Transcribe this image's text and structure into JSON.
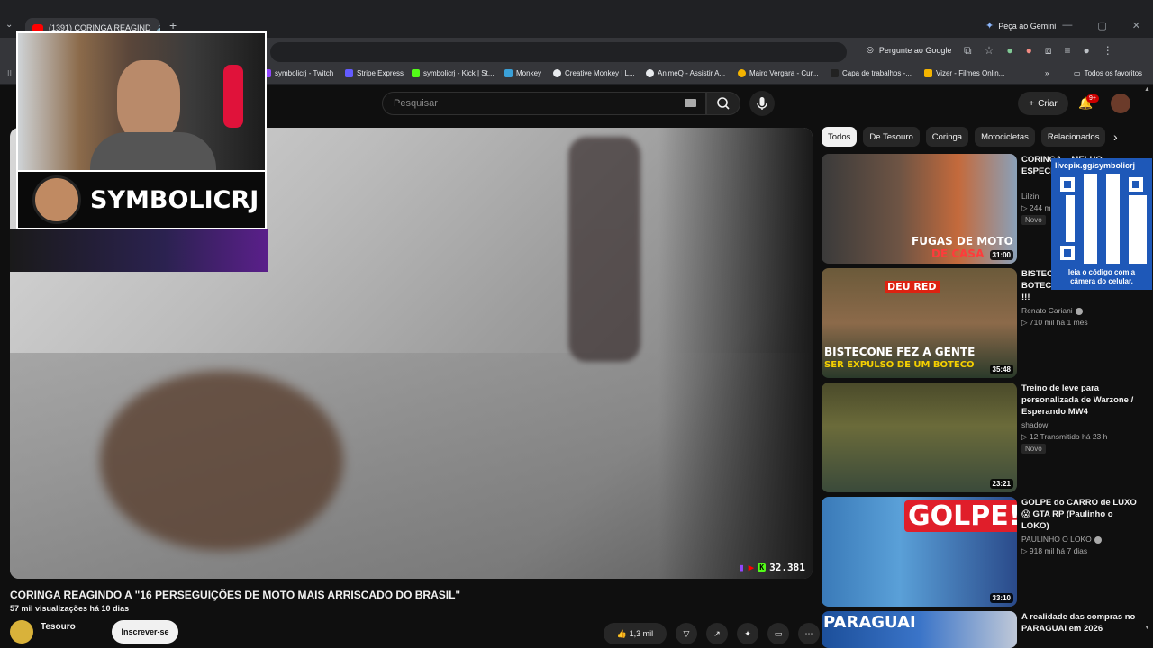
{
  "browser": {
    "tab_title": "(1391) CORINGA REAGIND",
    "new_tab": "+",
    "gemini_label": "Peça ao Gemini",
    "pergunte_label": "Pergunte ao Google",
    "window_controls": [
      "—",
      "▢",
      "✕"
    ]
  },
  "bookmarks": [
    {
      "label": "symbolicrj - Twitch",
      "color": "#9146ff"
    },
    {
      "label": "Stripe Express",
      "color": "#635bff"
    },
    {
      "label": "symbolicrj - Kick | St...",
      "color": "#53fc18"
    },
    {
      "label": "Monkey",
      "color": "#3aa0d8"
    },
    {
      "label": "Creative Monkey | L...",
      "color": "#e8eaed"
    },
    {
      "label": "AnimeQ - Assistir A...",
      "color": "#e8eaed"
    },
    {
      "label": "Mairo Vergara - Cur...",
      "color": "#f4b400"
    },
    {
      "label": "Capa de trabalhos -...",
      "color": "#222"
    },
    {
      "label": "Vizer - Filmes Onlin...",
      "color": "#f4b400"
    },
    {
      "label": "»",
      "color": "transparent"
    },
    {
      "label": "Todos os favoritos",
      "color": "transparent"
    }
  ],
  "youtube": {
    "search_placeholder": "Pesquisar",
    "create_label": "Criar",
    "notification_count": "9+"
  },
  "overlay": {
    "streamer_name": "SYMBOLICRJ",
    "viewer_count": "32.381",
    "qr_url": "livepix.gg/symbolicrj",
    "qr_caption": "leia o código com a câmera do celular."
  },
  "video": {
    "title": "CORINGA REAGINDO A \"16 PERSEGUIÇÕES DE MOTO MAIS ARRISCADO DO BRASIL\"",
    "meta": "57 mil visualizações  há 10 dias",
    "channel": "Tesouro",
    "subscribe_label": "Inscrever-se",
    "like_count": "1,3 mil"
  },
  "chips": [
    "Todos",
    "De Tesouro",
    "Coringa",
    "Motocicletas",
    "Relacionados"
  ],
  "recommendations": [
    {
      "title": "CORINGA... MELHO... ESPECI...",
      "channel": "Lilzin",
      "stats": "▷ 244 m",
      "badge": "Novo",
      "duration": "31:00",
      "thumb_text_1": "FUGAS DE MOTO",
      "thumb_text_2": "DE CASA"
    },
    {
      "title": "BISTEC... SER EX... BOTECO RAIZ - DEU RUIM !!!",
      "channel": "Renato Cariani",
      "stats": "▷ 710 mil  há 1 mês",
      "badge": "",
      "duration": "35:48",
      "thumb_text_1": "BISTECONE FEZ A GENTE",
      "thumb_text_2": "SER EXPULSO DE UM BOTECO",
      "thumb_text_3": "DEU RED"
    },
    {
      "title": "Treino de leve para personalizada de Warzone / Esperando MW4",
      "channel": "shadow",
      "stats": "▷ 12  Transmitido há 23 h",
      "badge": "Novo",
      "duration": "23:21"
    },
    {
      "title": "GOLPE do CARRO de LUXO 😱 GTA RP (Paulinho o LOKO)",
      "channel": "PAULINHO O LOKO",
      "stats": "▷ 918 mil  há 7 dias",
      "badge": "",
      "duration": "33:10",
      "thumb_text_1": "GOLPE!"
    },
    {
      "title": "A realidade das compras no PARAGUAI em 2026",
      "channel": "",
      "stats": "",
      "badge": "",
      "duration": "",
      "thumb_text_1": "PARAGUAI"
    }
  ],
  "colors": {
    "accent": "#ff0000",
    "kick": "#53fc18",
    "qr": "#1e58b8"
  }
}
